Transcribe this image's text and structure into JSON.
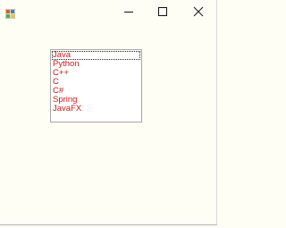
{
  "window": {
    "icon": "app-icon",
    "controls": [
      "minimize-icon",
      "maximize-icon",
      "close-icon"
    ]
  },
  "listbox": {
    "items": [
      "Java",
      "Python",
      "C++",
      "C",
      "C#",
      "Spring",
      "JavaFX"
    ],
    "focused_index": 0,
    "item_color": "#cc1b1b"
  }
}
